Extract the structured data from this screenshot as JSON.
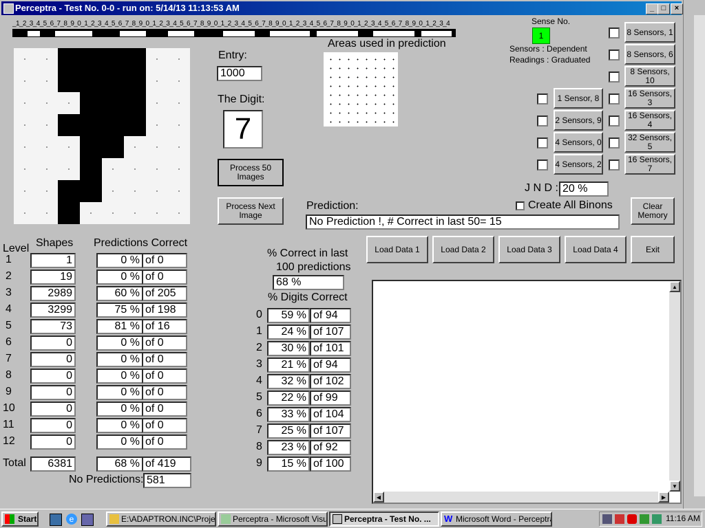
{
  "window": {
    "title": "Perceptra - Test No. 0-0 - run on: 5/14/13  11:13:53 AM"
  },
  "ruler": {
    "text": "_1_2_3_4_5_6_7_8_9_0_1_2_3_4_5_6_7_8_9_0_1_2_3_4_5_6_7_8_9_0_1_2_3_4_5_6_7_8_9_0_1_2_3_4_5_6_7_8_9_0_1_2_3_4_5_6_7_8_9_0_1_2_3_4"
  },
  "sense": {
    "label": "Sense No.",
    "value": "1",
    "sensors_line": "Sensors  :  Dependent",
    "readings_line": "Readings : Graduated"
  },
  "entry": {
    "label": "Entry:",
    "value": "1000"
  },
  "digit": {
    "label": "The Digit:",
    "value": "7"
  },
  "areas": {
    "label": "Areas used in prediction"
  },
  "buttons": {
    "process50": "Process 50\nImages",
    "process_next": "Process Next\nImage",
    "clear_memory": "Clear\nMemory",
    "load1": "Load Data 1",
    "load2": "Load Data 2",
    "load3": "Load Data 3",
    "load4": "Load Data 4",
    "exit": "Exit"
  },
  "sensor_buttons": {
    "right": [
      "8 Sensors, 1",
      "8 Sensors, 6",
      "8 Sensors, 10",
      "16 Sensors, 3",
      "16 Sensors, 4",
      "32 Sensors, 5",
      "16 Sensors, 7"
    ],
    "left": [
      "1 Sensor, 8",
      "2 Sensors, 9",
      "4 Sensors, 0",
      "4 Sensors, 2"
    ]
  },
  "jnd": {
    "label": "J N D :",
    "value": "20 %"
  },
  "create_all_binons": "Create All Binons",
  "prediction": {
    "label": "Prediction:",
    "value": "No Prediction !, # Correct in last 50= 15"
  },
  "levels": {
    "header_level": "Level",
    "header_shapes": "Shapes",
    "header_predictions": "Predictions Correct",
    "rows": [
      {
        "level": "1",
        "shapes": "1",
        "pct": "0 %",
        "of": "of 0"
      },
      {
        "level": "2",
        "shapes": "19",
        "pct": "0 %",
        "of": "of 0"
      },
      {
        "level": "3",
        "shapes": "2989",
        "pct": "60 %",
        "of": "of 205"
      },
      {
        "level": "4",
        "shapes": "3299",
        "pct": "75 %",
        "of": "of 198"
      },
      {
        "level": "5",
        "shapes": "73",
        "pct": "81 %",
        "of": "of 16"
      },
      {
        "level": "6",
        "shapes": "0",
        "pct": "0 %",
        "of": "of 0"
      },
      {
        "level": "7",
        "shapes": "0",
        "pct": "0 %",
        "of": "of 0"
      },
      {
        "level": "8",
        "shapes": "0",
        "pct": "0 %",
        "of": "of 0"
      },
      {
        "level": "9",
        "shapes": "0",
        "pct": "0 %",
        "of": "of 0"
      },
      {
        "level": "10",
        "shapes": "0",
        "pct": "0 %",
        "of": "of 0"
      },
      {
        "level": "11",
        "shapes": "0",
        "pct": "0 %",
        "of": "of 0"
      },
      {
        "level": "12",
        "shapes": "0",
        "pct": "0 %",
        "of": "of 0"
      }
    ],
    "total_label": "Total",
    "total_shapes": "6381",
    "total_pct": "68 %",
    "total_of": "of 419",
    "no_predictions_label": "No Predictions:",
    "no_predictions": "581"
  },
  "last100": {
    "label1": "% Correct in last",
    "label2": "100 predictions",
    "value": "68 %"
  },
  "digits": {
    "label": "% Digits Correct",
    "rows": [
      {
        "d": "0",
        "pct": "59 %",
        "of": "of 94"
      },
      {
        "d": "1",
        "pct": "24 %",
        "of": "of 107"
      },
      {
        "d": "2",
        "pct": "30 %",
        "of": "of 101"
      },
      {
        "d": "3",
        "pct": "21 %",
        "of": "of 94"
      },
      {
        "d": "4",
        "pct": "32 %",
        "of": "of 102"
      },
      {
        "d": "5",
        "pct": "22 %",
        "of": "of 99"
      },
      {
        "d": "6",
        "pct": "33 %",
        "of": "of 104"
      },
      {
        "d": "7",
        "pct": "25 %",
        "of": "of 107"
      },
      {
        "d": "8",
        "pct": "23 %",
        "of": "of 92"
      },
      {
        "d": "9",
        "pct": "15 %",
        "of": "of 100"
      }
    ]
  },
  "taskbar": {
    "start": "Start",
    "tasks": [
      "E:\\ADAPTRON.INC\\Proje...",
      "Perceptra - Microsoft Visua...",
      "Perceptra - Test No. ...",
      "Microsoft Word - Perceptra..."
    ],
    "clock": "11:16 AM"
  }
}
